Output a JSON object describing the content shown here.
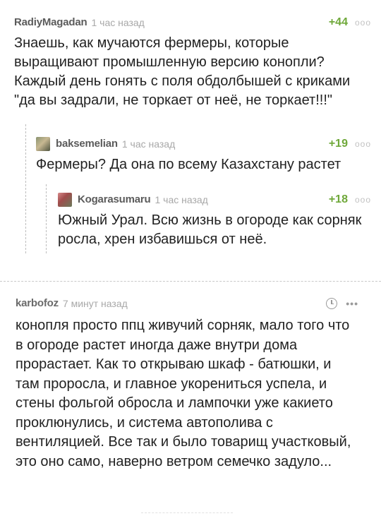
{
  "comments": [
    {
      "author": "RadiyMagadan",
      "time": "1 час назад",
      "rating": "+44",
      "more": "ooo",
      "text": "Знаешь, как мучаются фермеры, которые выращивают промышленную версию конопли? Каждый день гонять с поля обдолбышей с криками \"да вы задрали, не торкает от неё, не торкает!!!\""
    },
    {
      "author": "baksemelian",
      "time": "1 час назад",
      "rating": "+19",
      "more": "ooo",
      "text": "Фермеры? Да она по всему Казахстану растет"
    },
    {
      "author": "Kogarasumaru",
      "time": "1 час назад",
      "rating": "+18",
      "more": "ooo",
      "text": "Южный Урал. Всю жизнь в огороде как сорняк росла, хрен избавишься от неё."
    },
    {
      "author": "karbofoz",
      "time": "7 минут назад",
      "more": "•••",
      "text": "конопля просто ппц живучий сорняк, мало того что в огороде растет иногда даже внутри дома прорастает. Как то открываю шкаф - батюшки, и там проросла, и главное укорениться успела, и  стены фольгой обросла и лампочки уже какието проклюнулись, и система автополива с вентиляцией. Все так и было товарищ участковый, это оно само, наверно ветром семечко задуло..."
    }
  ],
  "icons": {
    "avatar_1": "avatar-image",
    "avatar_2": "avatar-image",
    "clock": "clock-icon"
  },
  "colors": {
    "rating": "#6fa83a",
    "author": "#5b5b5b",
    "time": "#a8a8a8"
  }
}
